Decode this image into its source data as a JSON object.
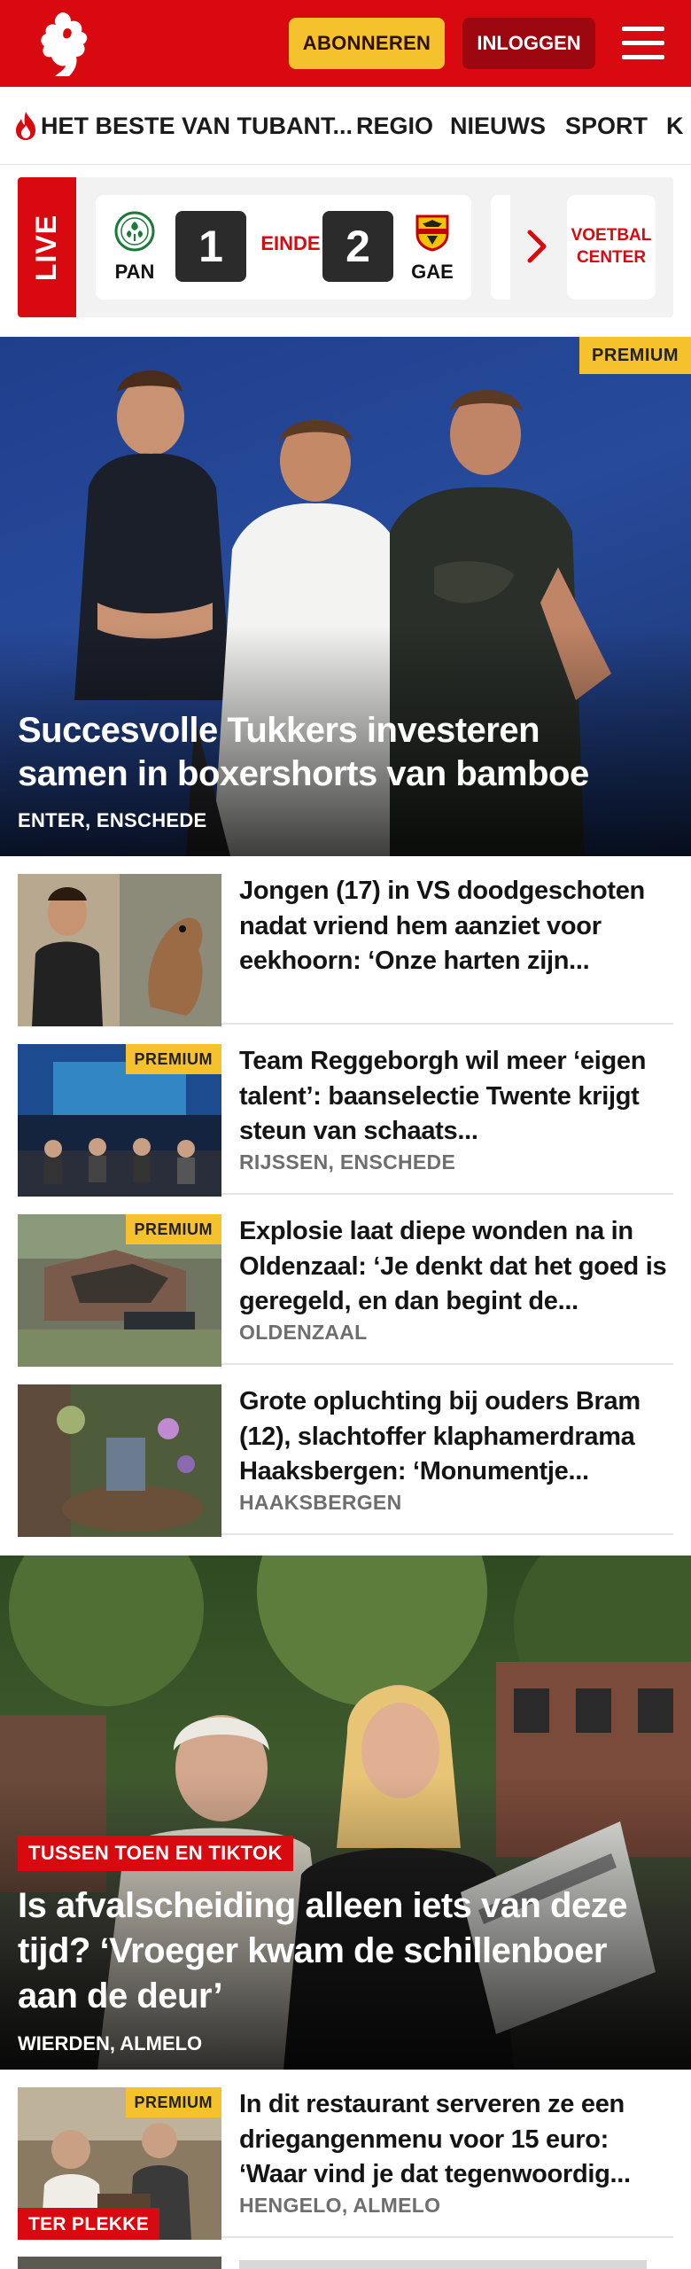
{
  "header": {
    "brand_color": "#d8090f",
    "subscribe_label": "ABONNEREN",
    "login_label": "INLOGGEN",
    "logo_icon": "twente-horse-logo",
    "menu_icon": "hamburger-menu-icon"
  },
  "nav": {
    "items": [
      {
        "label": "HET BESTE VAN TUBANT...",
        "icon": "flame-icon"
      },
      {
        "label": "REGIO"
      },
      {
        "label": "NIEUWS"
      },
      {
        "label": "SPORT"
      },
      {
        "label": "K"
      }
    ]
  },
  "live": {
    "tag": "LIVE",
    "home_team": "PAN",
    "away_team": "GAE",
    "home_score": "1",
    "away_score": "2",
    "status": "EINDE",
    "cta": "VOETBAL CENTER"
  },
  "hero": {
    "badge": "PREMIUM",
    "title": "Succesvolle Tukkers investeren samen in boxershorts van bamboe",
    "meta": "ENTER, ENSCHEDE"
  },
  "articles": [
    {
      "title": "Jongen (17) in VS doodgeschoten nadat vriend hem aanziet voor eekhoorn: ‘Onze harten zijn...",
      "meta": "",
      "badge": ""
    },
    {
      "title": "Team Reggeborgh wil meer ‘eigen talent’: baanselectie Twente krijgt steun van schaats...",
      "meta": "RIJSSEN, ENSCHEDE",
      "badge": "PREMIUM"
    },
    {
      "title": "Explosie laat diepe wonden na in Oldenzaal: ‘Je denkt dat het goed is geregeld, en dan begint de...",
      "meta": "OLDENZAAL",
      "badge": "PREMIUM"
    },
    {
      "title": "Grote opluchting bij ouders Bram (12), slachtoffer klaphamerdra­ma Haaksbergen: ‘Monumentje...",
      "meta": "HAAKSBERGEN",
      "badge": ""
    }
  ],
  "hero2": {
    "tag": "TUSSEN TOEN EN TIKTOK",
    "title": "Is afvalscheiding alleen iets van deze tijd? ‘Vroeger kwam de schillenboer aan de deur’",
    "meta": "WIERDEN, ALMELO"
  },
  "article_last": {
    "title": "In dit restaurant serveren ze een driegangenmenu voor 15 euro: ‘Waar vind je dat tegenwoordig...",
    "meta": "HENGELO, ALMELO",
    "badge": "PREMIUM",
    "tag": "TER PLEKKE"
  }
}
